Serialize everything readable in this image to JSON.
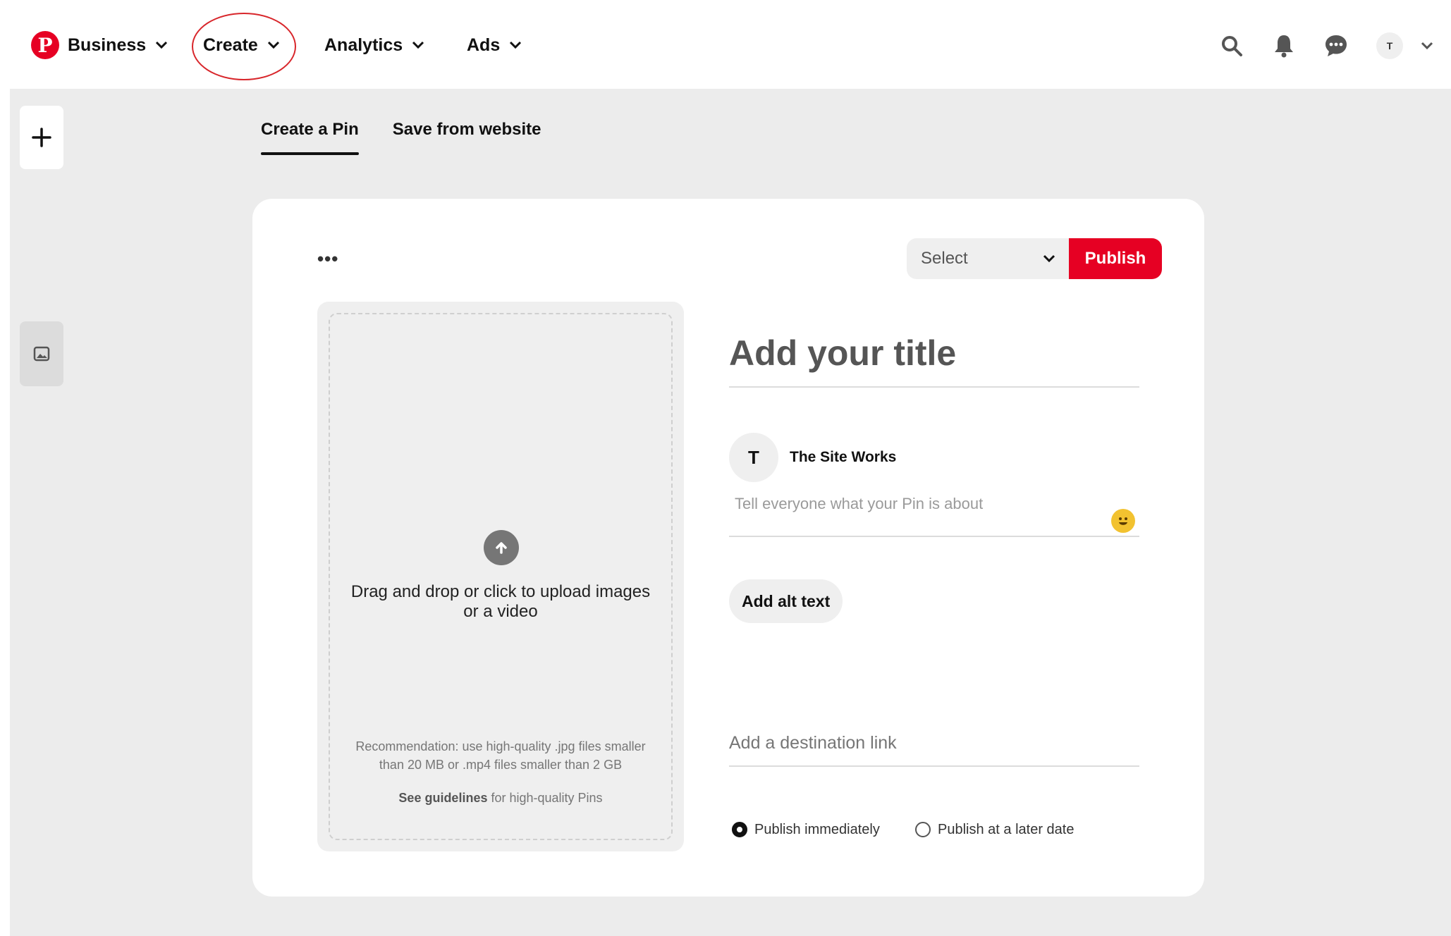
{
  "nav": {
    "logo_letter": "P",
    "business_label": "Business",
    "create_label": "Create",
    "analytics_label": "Analytics",
    "ads_label": "Ads",
    "avatar_letter": "T"
  },
  "tabs": [
    {
      "label": "Create a Pin",
      "active": true
    },
    {
      "label": "Save from website",
      "active": false
    }
  ],
  "card": {
    "more_label": "•••",
    "board_select": {
      "selected": "Select"
    },
    "publish_label": "Publish",
    "upload": {
      "prompt": "Drag and drop or click to upload images or a video",
      "recommendation": "Recommendation: use high-quality .jpg files smaller than 20 MB or .mp4 files smaller than 2 GB",
      "guidelines_link": "See guidelines",
      "guidelines_rest": " for high-quality Pins"
    },
    "title_placeholder": "Add your title",
    "owner": {
      "initial": "T",
      "name": "The Site Works"
    },
    "description_placeholder": "Tell everyone what your Pin is about",
    "alt_text_label": "Add alt text",
    "link_placeholder": "Add a destination link",
    "publish_options": [
      {
        "label": "Publish immediately",
        "selected": true
      },
      {
        "label": "Publish at a later date",
        "selected": false
      }
    ]
  },
  "colors": {
    "brand": "#e60023",
    "annotation_ring": "#d8262b",
    "canvas": "#ececec"
  }
}
